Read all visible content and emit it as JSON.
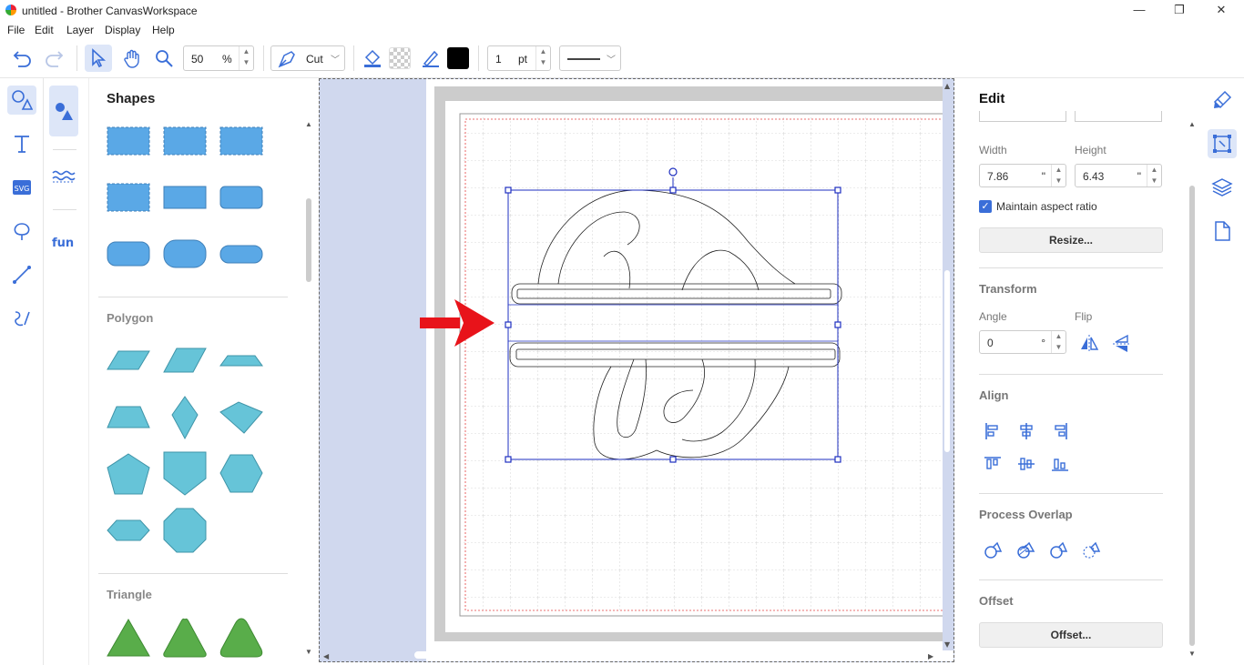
{
  "window": {
    "title": "untitled - Brother CanvasWorkspace",
    "minimize": "—",
    "maximize": "❐",
    "close": "✕"
  },
  "menu": [
    "File",
    "Edit",
    "Layer",
    "Display",
    "Help"
  ],
  "toolbar": {
    "zoom_value": "50",
    "zoom_unit": "%",
    "mode": "Cut",
    "line_width_value": "1",
    "line_width_unit": "pt",
    "icons": [
      "undo-icon",
      "redo-icon",
      "select-icon",
      "pan-hand-icon",
      "zoom-icon",
      "cut-pen-icon",
      "fill-bucket-icon",
      "transparent-fill-icon",
      "line-pen-icon",
      "line-color-swatch-icon",
      "line-style-icon"
    ],
    "line_color": "#000000"
  },
  "left_tools": [
    "shapes-icon",
    "text-icon",
    "svg-icon",
    "fill-pattern-icon",
    "line-icon",
    "freehand-icon"
  ],
  "sub_tools": [
    "basic-shapes-icon",
    "wave-border-icon",
    "fun-text-icon"
  ],
  "shapes_panel": {
    "title": "Shapes",
    "categories": [
      "Polygon",
      "Triangle"
    ]
  },
  "edit_panel": {
    "title": "Edit",
    "width_label": "Width",
    "height_label": "Height",
    "width_value": "7.86",
    "height_value": "6.43",
    "unit": "\"",
    "maintain_aspect": "Maintain aspect ratio",
    "maintain_aspect_checked": true,
    "resize_button": "Resize...",
    "transform_title": "Transform",
    "angle_label": "Angle",
    "angle_value": "0",
    "angle_unit": "°",
    "flip_label": "Flip",
    "align_title": "Align",
    "process_overlap_title": "Process Overlap",
    "offset_title": "Offset",
    "offset_button": "Offset..."
  },
  "right_tools": [
    "paint-brush-icon",
    "edit-transform-icon",
    "layers-icon",
    "page-icon"
  ],
  "colors": {
    "accent": "#3a6ed8",
    "selection": "#1e2fc0",
    "shape_blue": "#5aa8e6",
    "shape_cyan": "#66c4d8",
    "shape_green": "#59ad4a",
    "canvas_bg": "#d0d8ee",
    "arrow_red": "#e8131a"
  }
}
